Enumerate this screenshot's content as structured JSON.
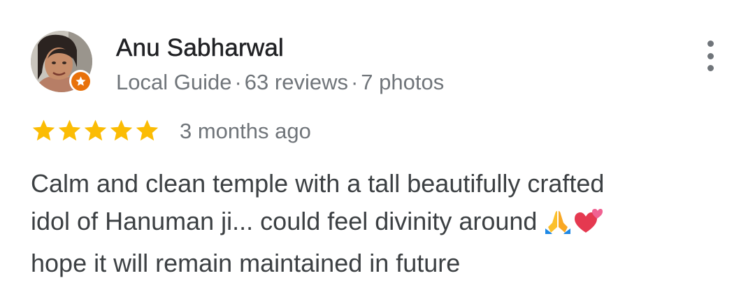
{
  "reviewer": {
    "name": "Anu Sabharwal",
    "badge_icon": "local-guide-star-icon",
    "badge_color": "#e8710a",
    "level": "Local Guide",
    "separator": "·",
    "reviews": "63 reviews",
    "photos": "7 photos"
  },
  "rating": {
    "stars": 5,
    "max_stars": 5,
    "star_color": "#fbbc04",
    "time": "3 months ago"
  },
  "review_text": {
    "line1": "Calm and clean temple with a tall beautifully crafted",
    "line2": "idol of Hanuman ji... could feel divinity around",
    "line3": "hope it will remain maintained in future",
    "emojis": [
      "folded-hands-emoji",
      "two-hearts-emoji"
    ]
  },
  "menu_icon": "more-vert-icon"
}
